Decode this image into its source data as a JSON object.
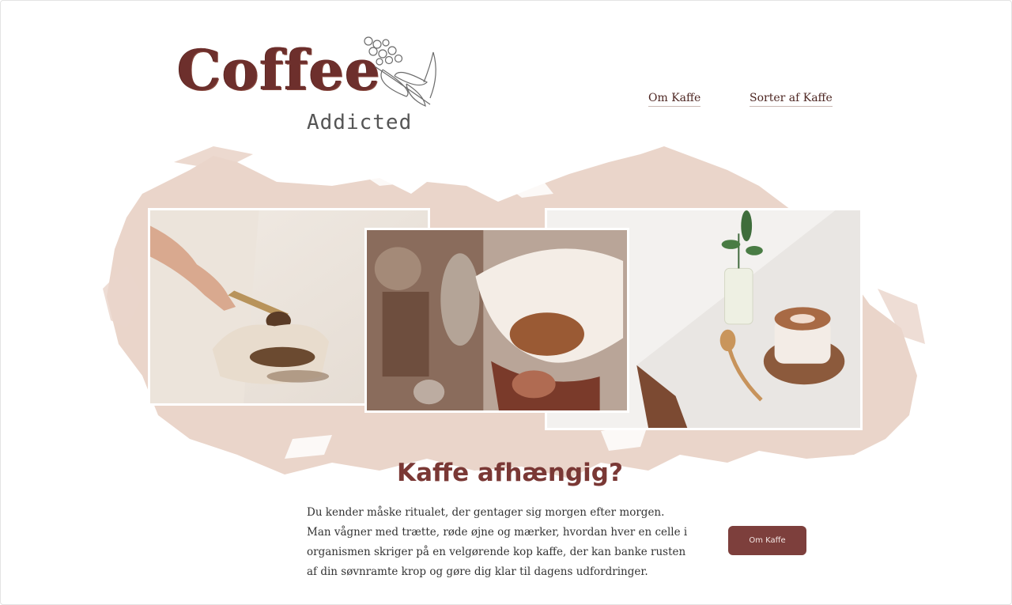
{
  "logo": {
    "title": "Coffee",
    "subtitle": "Addicted",
    "icon": "coffee-branch-icon"
  },
  "nav": {
    "items": [
      {
        "label": "Om Kaffe"
      },
      {
        "label": "Sorter af Kaffe"
      }
    ]
  },
  "hero": {
    "photos": [
      {
        "name": "coffee-beans-scoop-photo"
      },
      {
        "name": "pour-over-filter-photo"
      },
      {
        "name": "latte-on-marble-photo"
      }
    ]
  },
  "main": {
    "heading": "Kaffe afhængig?",
    "paragraph_lines": [
      "Du kender måske ritualet, der gentager sig morgen efter morgen.",
      "Man vågner med trætte, røde øjne og mærker, hvordan hver en celle i",
      "organismen skriger på en velgørende kop kaffe, der kan banke rusten",
      "af din søvnramte krop og gøre dig klar til dagens udfordringer."
    ],
    "cta_label": "Om Kaffe"
  },
  "colors": {
    "accent": "#7d3f3c",
    "heading": "#7a3835",
    "brush": "#ead5ca"
  }
}
